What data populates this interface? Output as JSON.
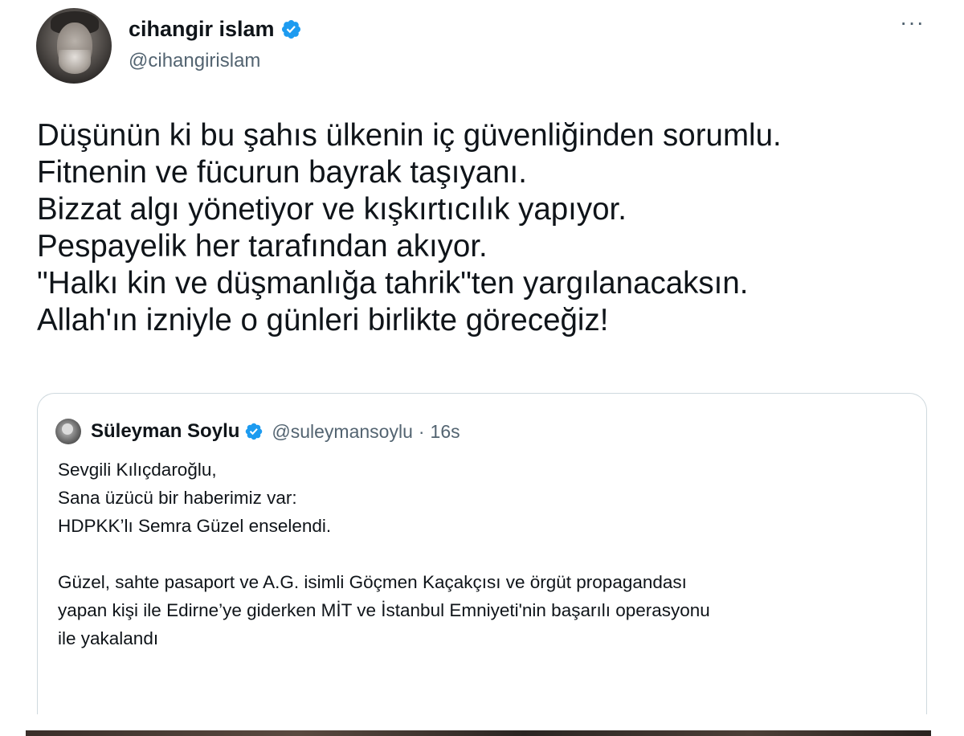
{
  "author": {
    "display_name": "cihangir islam",
    "handle": "@cihangirislam",
    "verified": true,
    "verified_icon": "verified-badge-icon",
    "more_icon": "more-options-icon",
    "more_label": "···"
  },
  "tweet": {
    "lines": [
      "Düşünün ki bu şahıs ülkenin iç güvenliğinden sorumlu.",
      "Fitnenin ve fücurun bayrak taşıyanı.",
      "Bizzat algı yönetiyor ve kışkırtıcılık yapıyor.",
      "Pespayelik her tarafından akıyor.",
      "\"Halkı kin ve düşmanlığa tahrik\"ten yargılanacaksın.",
      "Allah'ın izniyle o günleri birlikte göreceğiz!"
    ]
  },
  "quoted_tweet": {
    "display_name": "Süleyman Soylu",
    "handle": "@suleymansoylu",
    "separator": "·",
    "time": "16s",
    "verified": true,
    "paragraph1": [
      "Sevgili Kılıçdaroğlu,",
      "Sana üzücü bir haberimiz var:",
      "HDPKK’lı Semra Güzel enselendi."
    ],
    "paragraph2": [
      "Güzel, sahte pasaport ve A.G. isimli Göçmen Kaçakçısı ve örgüt propagandası",
      "yapan kişi ile Edirne’ye giderken MİT ve İstanbul Emniyeti'nin başarılı operasyonu",
      "ile yakalandı"
    ]
  },
  "colors": {
    "text_primary": "#0f1419",
    "text_secondary": "#536471",
    "verified_blue": "#1d9bf0",
    "border": "#cfd9de"
  }
}
